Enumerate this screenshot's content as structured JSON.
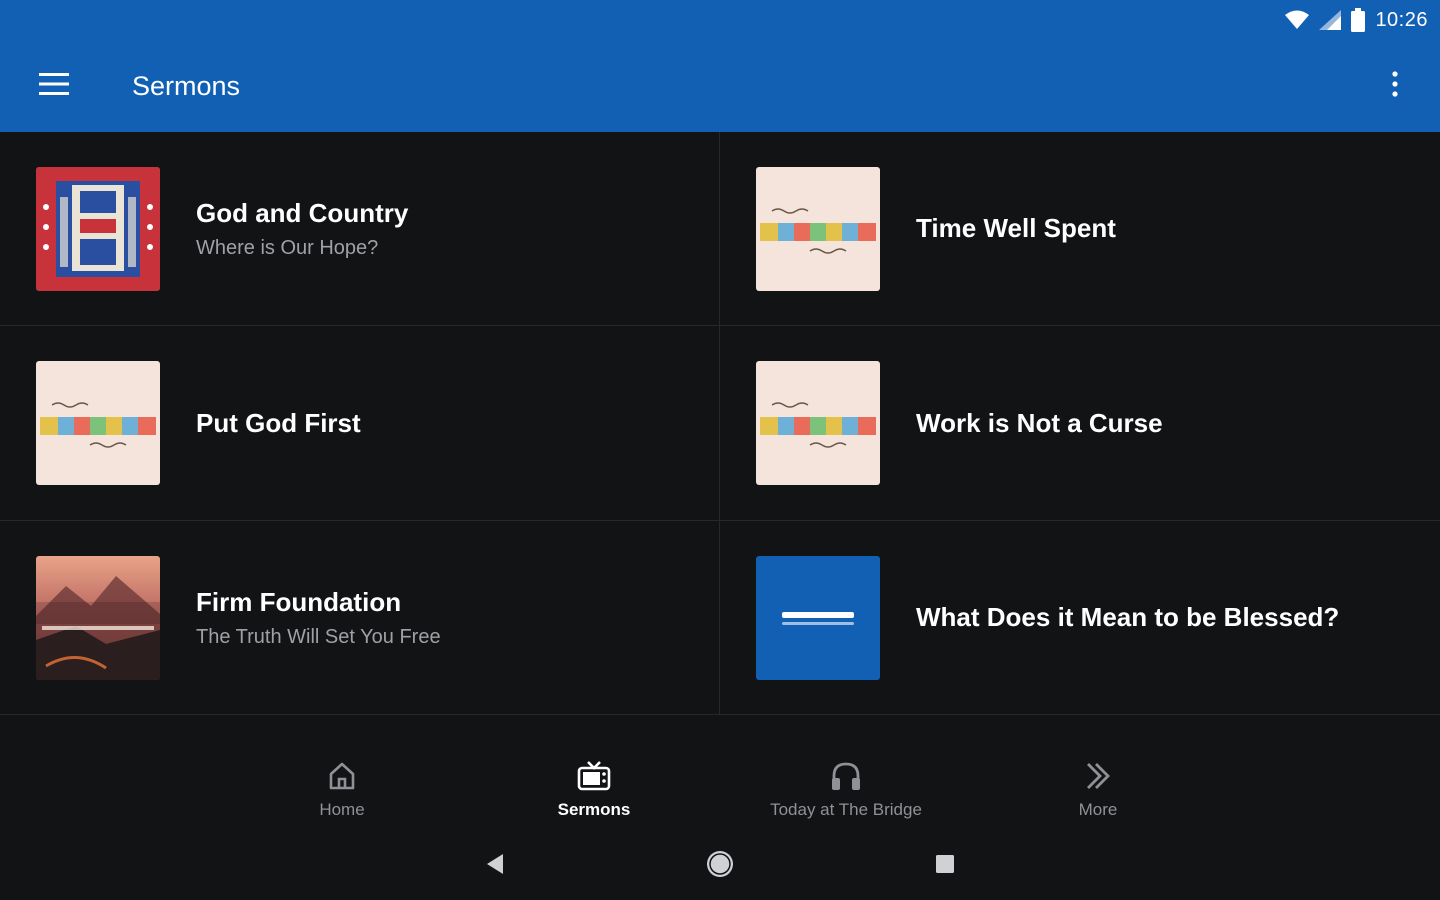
{
  "status_bar": {
    "time": "10:26"
  },
  "app_bar": {
    "title": "Sermons"
  },
  "sermons": [
    {
      "title": "God and Country",
      "subtitle": "Where is Our Hope?",
      "thumb": "god-and-country"
    },
    {
      "title": "Time Well Spent",
      "subtitle": "",
      "thumb": "whatever"
    },
    {
      "title": "Put God First",
      "subtitle": "",
      "thumb": "whatever"
    },
    {
      "title": "Work is Not a Curse",
      "subtitle": "",
      "thumb": "whatever"
    },
    {
      "title": "Firm Foundation",
      "subtitle": "The Truth Will Set You Free",
      "thumb": "firm-foundation"
    },
    {
      "title": "What Does it Mean to be Blessed?",
      "subtitle": "",
      "thumb": "the-bridge"
    }
  ],
  "bottom_nav": [
    {
      "label": "Home",
      "icon": "home-icon",
      "active": false
    },
    {
      "label": "Sermons",
      "icon": "tv-icon",
      "active": true
    },
    {
      "label": "Today at The Bridge",
      "icon": "headphones-icon",
      "active": false
    },
    {
      "label": "More",
      "icon": "chevrons-right-icon",
      "active": false
    }
  ],
  "colors": {
    "primary": "#1160b4",
    "background": "#121315",
    "divider": "#26282b",
    "secondary_text": "#9ea1a6"
  }
}
